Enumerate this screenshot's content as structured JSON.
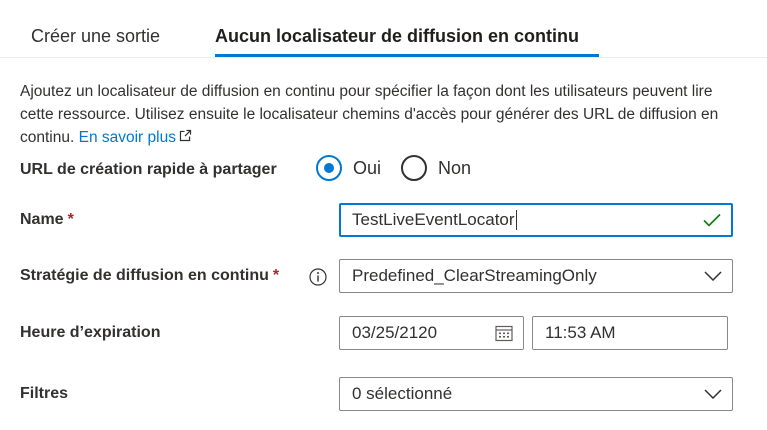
{
  "tabs": {
    "create_output": "Créer une sortie",
    "no_locator": "Aucun localisateur de diffusion en continu"
  },
  "description": {
    "text": "Ajoutez un localisateur de diffusion en continu pour spécifier la façon dont les utilisateurs peuvent lire cette ressource. Utilisez ensuite le localisateur chemins d'accès pour générer des URL de diffusion en continu.",
    "learn_more": "En savoir plus"
  },
  "quick_url": {
    "label": "URL de création rapide à partager",
    "options": [
      "Oui",
      "Non"
    ],
    "selected": "Oui"
  },
  "name": {
    "label": "Name",
    "required_mark": "*",
    "value": "TestLiveEventLocator"
  },
  "policy": {
    "label": "Stratégie de diffusion en continu",
    "required_mark": "*",
    "value": "Predefined_ClearStreamingOnly"
  },
  "expiration": {
    "label": "Heure d’expiration",
    "date": "03/25/2120",
    "time": "11:53 AM"
  },
  "filters": {
    "label": "Filtres",
    "value": "0 sélectionné"
  },
  "colors": {
    "accent": "#0078d4",
    "required": "#a4262c",
    "valid": "#107c10",
    "text": "#323130"
  },
  "icons": [
    "external-link-icon",
    "checkmark-icon",
    "info-icon",
    "chevron-down-icon",
    "calendar-icon"
  ]
}
